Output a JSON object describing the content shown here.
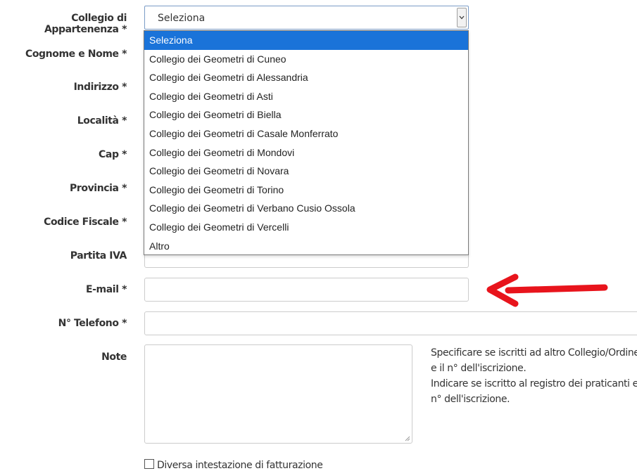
{
  "form": {
    "collegio": {
      "label": "Collegio di Appartenenza *",
      "selected": "Seleziona",
      "options": [
        "Seleziona",
        "Collegio dei Geometri di Cuneo",
        "Collegio dei Geometri di Alessandria",
        "Collegio dei Geometri di Asti",
        "Collegio dei Geometri di Biella",
        "Collegio dei Geometri di Casale Monferrato",
        "Collegio dei Geometri di Mondovi",
        "Collegio dei Geometri di Novara",
        "Collegio dei Geometri di Torino",
        "Collegio dei Geometri di Verbano Cusio Ossola",
        "Collegio dei Geometri di Vercelli",
        "Altro"
      ],
      "highlighted_option": "Seleziona"
    },
    "cognome_nome": {
      "label": "Cognome e Nome *",
      "value": ""
    },
    "indirizzo": {
      "label": "Indirizzo *",
      "value": ""
    },
    "localita": {
      "label": "Località *",
      "value": ""
    },
    "cap": {
      "label": "Cap *",
      "value": ""
    },
    "provincia": {
      "label": "Provincia *",
      "value": ""
    },
    "codice_fiscale": {
      "label": "Codice Fiscale *",
      "value": ""
    },
    "partita_iva": {
      "label": "Partita IVA",
      "value": ""
    },
    "email": {
      "label": "E-mail *",
      "value": ""
    },
    "telefono": {
      "label": "N° Telefono *",
      "value": ""
    },
    "note": {
      "label": "Note",
      "value": "",
      "hint_line1": "Specificare se iscritti ad altro Collegio/Ordine e il n° dell'iscrizione.",
      "hint_line2": "Indicare se iscritto al registro dei praticanti e n° dell'iscrizione."
    },
    "fatturazione": {
      "label": "Diversa intestazione di fatturazione",
      "checked": false
    }
  },
  "colors": {
    "highlight": "#1a73d9",
    "arrow": "#e8141c",
    "border": "#cccccc"
  },
  "annotation": {
    "icon": "red-arrow-left-icon"
  }
}
